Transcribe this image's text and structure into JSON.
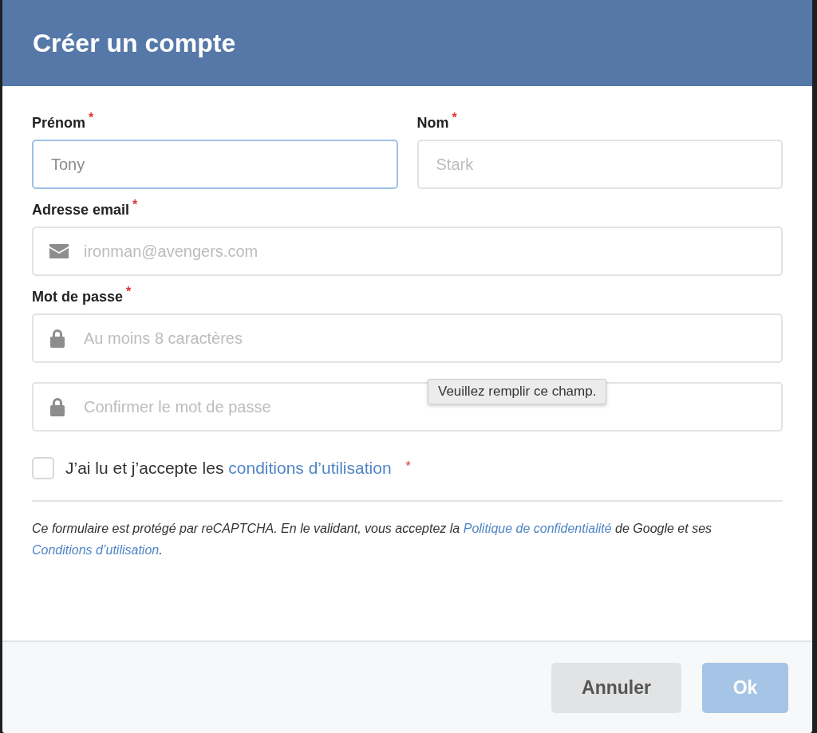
{
  "dialog": {
    "title": "Créer un compte"
  },
  "name_fields": [
    {
      "label": "Prénom",
      "asterisk": "*",
      "placeholder": "Tony",
      "focused": true
    },
    {
      "label": "Nom",
      "asterisk": "*",
      "placeholder": "Stark",
      "focused": false
    }
  ],
  "email": {
    "label": "Adresse email",
    "asterisk": "*",
    "placeholder": "ironman@avengers.com",
    "focused": false
  },
  "password": {
    "label": "Mot de passe",
    "asterisk": "*",
    "placeholder": "Au moins 8 caractères",
    "focused": false
  },
  "confirm": {
    "placeholder": "Confirmer le mot de passe",
    "focused": false,
    "tooltip": "Veuillez remplir ce champ."
  },
  "terms": {
    "checked": false,
    "text": "J’ai lu et j’accepte les",
    "link": "conditions d’utilisation",
    "asterisk": "*"
  },
  "notice": {
    "before": "Ce formulaire est protégé par reCAPTCHA. En le validant, vous acceptez la",
    "link1": "Politique de confidentialité",
    "middle": "de Google et ses",
    "link2": "Conditions d’utilisation",
    "after": "."
  },
  "buttons": [
    {
      "label": "Annuler",
      "kind": "secondary",
      "disabled": false
    },
    {
      "label": "Ok",
      "kind": "primary",
      "disabled": true
    }
  ]
}
